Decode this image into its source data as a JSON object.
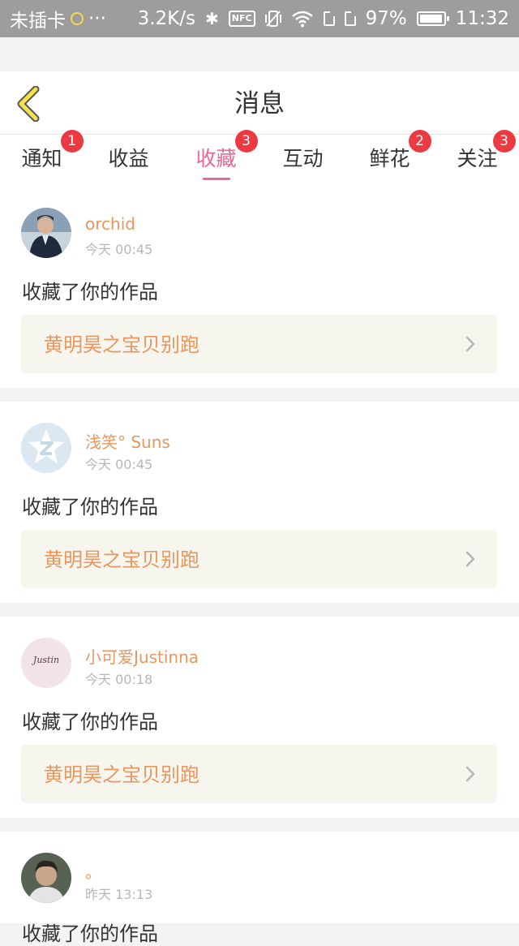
{
  "status_bar": {
    "carrier": "未插卡",
    "dots": "···",
    "net_speed": "3.2K/s",
    "bluetooth_glyph": "✱",
    "nfc": "NFC",
    "battery_percent": "97%",
    "battery_level": 0.97,
    "time": "11:32"
  },
  "header": {
    "title": "消息"
  },
  "tabs": [
    {
      "label": "通知",
      "badge": "1"
    },
    {
      "label": "收益",
      "badge": ""
    },
    {
      "label": "收藏",
      "badge": "3",
      "active": true
    },
    {
      "label": "互动",
      "badge": ""
    },
    {
      "label": "鲜花",
      "badge": "2"
    },
    {
      "label": "关注",
      "badge": "3"
    }
  ],
  "messages": [
    {
      "username": "orchid",
      "time": "今天 00:45",
      "action": "收藏了你的作品",
      "work_title": "黄明昊之宝贝别跑",
      "avatar": "avatar-photo-man-suit"
    },
    {
      "username": "浅笑° Suns",
      "time": "今天 00:45",
      "action": "收藏了你的作品",
      "work_title": "黄明昊之宝贝别跑",
      "avatar": "avatar-default-star"
    },
    {
      "username": "小可爱Justinna",
      "time": "今天 00:18",
      "action": "收藏了你的作品",
      "work_title": "黄明昊之宝贝别跑",
      "avatar": "avatar-text-justin",
      "avatar_text": "Justin"
    },
    {
      "username": "。",
      "time": "昨天 13:13",
      "action": "收藏了你的作品",
      "avatar": "avatar-photo-man"
    }
  ],
  "colors": {
    "accent_pink": "#e8679a",
    "username_orange": "#e9965e",
    "badge_red": "#ec3a43",
    "back_arrow_yellow": "#f3e04a"
  }
}
